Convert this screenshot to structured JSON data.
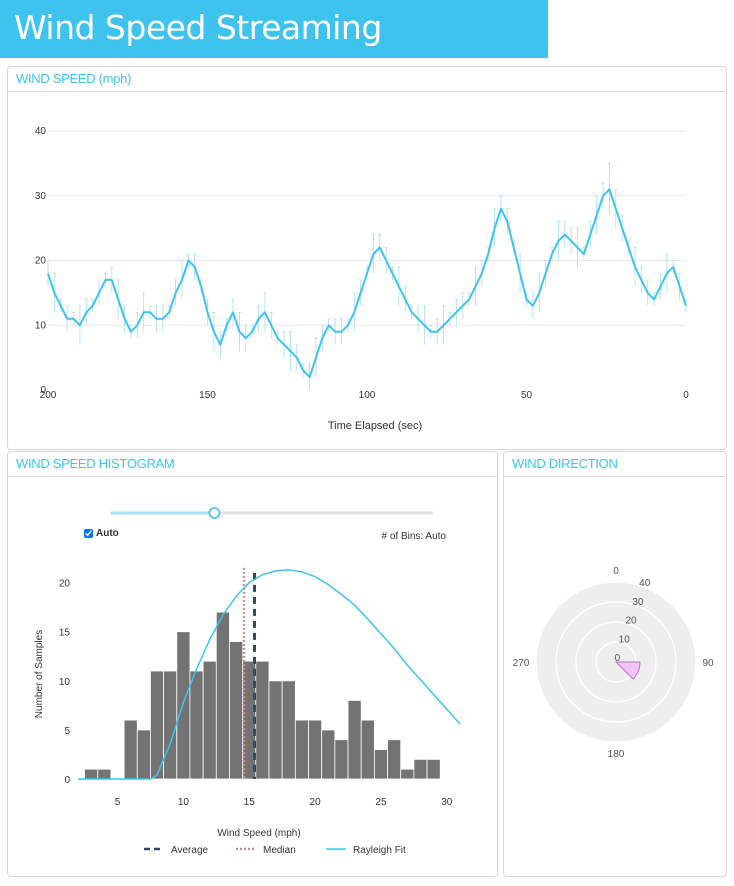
{
  "app": {
    "title": "Wind Speed Streaming"
  },
  "panels": {
    "speed": {
      "title": "WIND SPEED (mph)"
    },
    "histogram": {
      "title": "WIND SPEED HISTOGRAM"
    },
    "direction": {
      "title": "WIND DIRECTION"
    }
  },
  "controls": {
    "auto_label": "Auto",
    "auto_checked": true,
    "bins_label": "# of Bins: Auto",
    "slider_fraction": 0.32
  },
  "colors": {
    "accent": "#3ec3ef",
    "bar": "#737373",
    "average": "#2b4a66",
    "median": "#c9908f",
    "rose": "#f0c4f2"
  },
  "chart_data": [
    {
      "type": "line",
      "xlabel": "Time Elapsed (sec)",
      "ylabel": "",
      "xlim": [
        200,
        0
      ],
      "ylim": [
        0,
        40
      ],
      "x_ticks": [
        "200",
        "150",
        "100",
        "50",
        "0"
      ],
      "y_ticks": [
        "0",
        "10",
        "20",
        "30",
        "40"
      ],
      "grid": true,
      "error_bars": true,
      "series": [
        {
          "x": [
            200,
            198,
            196,
            194,
            192,
            190,
            188,
            186,
            184,
            182,
            180,
            178,
            176,
            174,
            172,
            170,
            168,
            166,
            164,
            162,
            160,
            158,
            156,
            154,
            152,
            150,
            148,
            146,
            144,
            142,
            140,
            138,
            136,
            134,
            132,
            130,
            128,
            126,
            124,
            122,
            120,
            118,
            116,
            114,
            112,
            110,
            108,
            106,
            104,
            102,
            100,
            98,
            96,
            94,
            92,
            90,
            88,
            86,
            84,
            82,
            80,
            78,
            76,
            74,
            72,
            70,
            68,
            66,
            64,
            62,
            60,
            58,
            56,
            54,
            52,
            50,
            48,
            46,
            44,
            42,
            40,
            38,
            36,
            34,
            32,
            30,
            28,
            26,
            24,
            22,
            20,
            18,
            16,
            14,
            12,
            10,
            8,
            6,
            4,
            2,
            0
          ],
          "values": [
            18,
            15,
            13,
            11,
            11,
            10,
            12,
            13,
            15,
            17,
            17,
            14,
            11,
            9,
            10,
            12,
            12,
            11,
            11,
            12,
            15,
            17,
            20,
            19,
            16,
            12,
            9,
            7,
            10,
            12,
            9,
            8,
            9,
            11,
            12,
            10,
            8,
            7,
            6,
            5,
            3,
            2,
            5,
            8,
            10,
            9,
            9,
            10,
            12,
            15,
            18,
            21,
            22,
            20,
            18,
            16,
            14,
            12,
            11,
            10,
            9,
            9,
            10,
            11,
            12,
            13,
            14,
            16,
            18,
            21,
            25,
            28,
            26,
            22,
            18,
            14,
            13,
            15,
            18,
            21,
            23,
            24,
            23,
            22,
            21,
            24,
            27,
            30,
            31,
            28,
            25,
            22,
            19,
            17,
            15,
            14,
            16,
            18,
            19,
            16,
            13
          ],
          "error": [
            2,
            3,
            1,
            2,
            1,
            3,
            2,
            1,
            2,
            1,
            2,
            3,
            2,
            1,
            2,
            3,
            1,
            2,
            2,
            1,
            2,
            3,
            1,
            2,
            1,
            2,
            3,
            2,
            1,
            2,
            3,
            2,
            1,
            2,
            3,
            2,
            1,
            2,
            3,
            2,
            1,
            2,
            3,
            2,
            1,
            2,
            2,
            1,
            3,
            2,
            1,
            3,
            2,
            2,
            1,
            3,
            2,
            1,
            2,
            3,
            1,
            2,
            3,
            1,
            2,
            2,
            1,
            3,
            2,
            1,
            3,
            2,
            2,
            1,
            3,
            1,
            2,
            3,
            2,
            1,
            3,
            2,
            2,
            3,
            1,
            2,
            3,
            2,
            4,
            3,
            2,
            1,
            3,
            2,
            2,
            1,
            2,
            3,
            1,
            2,
            1
          ]
        }
      ]
    },
    {
      "type": "bar",
      "xlabel": "Wind Speed (mph)",
      "ylabel": "Number of Samples",
      "xlim": [
        2,
        31
      ],
      "ylim": [
        0,
        22
      ],
      "x_ticks": [
        "5",
        "10",
        "15",
        "20",
        "25",
        "30"
      ],
      "y_ticks": [
        "0",
        "5",
        "10",
        "15",
        "20"
      ],
      "bin_width": 1,
      "bin_starts": [
        2.5,
        3.5,
        4.5,
        5.5,
        6.5,
        7.5,
        8.5,
        9.5,
        10.5,
        11.5,
        12.5,
        13.5,
        14.5,
        15.5,
        16.5,
        17.5,
        18.5,
        19.5,
        20.5,
        21.5,
        22.5,
        23.5,
        24.5,
        25.5,
        26.5,
        27.5,
        28.5
      ],
      "counts": [
        1,
        1,
        0,
        6,
        5,
        11,
        11,
        15,
        11,
        12,
        17,
        14,
        12,
        12,
        10,
        10,
        6,
        6,
        5,
        4,
        8,
        6,
        3,
        4,
        1,
        2,
        2
      ],
      "average": 15.4,
      "median": 14.6,
      "rayleigh_fit": {
        "x": [
          2,
          4,
          6,
          7.5,
          8,
          9,
          10,
          11,
          12,
          13,
          14,
          15,
          16,
          17,
          18,
          19,
          20,
          21,
          22,
          23,
          24,
          25,
          26,
          27,
          28,
          29,
          30,
          31
        ],
        "y": [
          0,
          0,
          0,
          0,
          0.4,
          3.6,
          7.8,
          11.2,
          14.2,
          16.7,
          18.6,
          20.0,
          20.8,
          21.2,
          21.3,
          21.1,
          20.6,
          19.8,
          18.8,
          17.7,
          16.3,
          14.8,
          13.3,
          11.6,
          10.1,
          8.6,
          7.1,
          5.6
        ]
      },
      "legend": [
        "Average",
        "Median",
        "Rayleigh Fit"
      ],
      "legend_position": "bottom"
    },
    {
      "type": "polar",
      "angle_labels": [
        "0",
        "90",
        "180",
        "270"
      ],
      "radial_ticks": [
        "0",
        "10",
        "20",
        "30",
        "40"
      ],
      "wedge": {
        "start_deg": 90,
        "end_deg": 135,
        "radius": 12
      }
    }
  ]
}
